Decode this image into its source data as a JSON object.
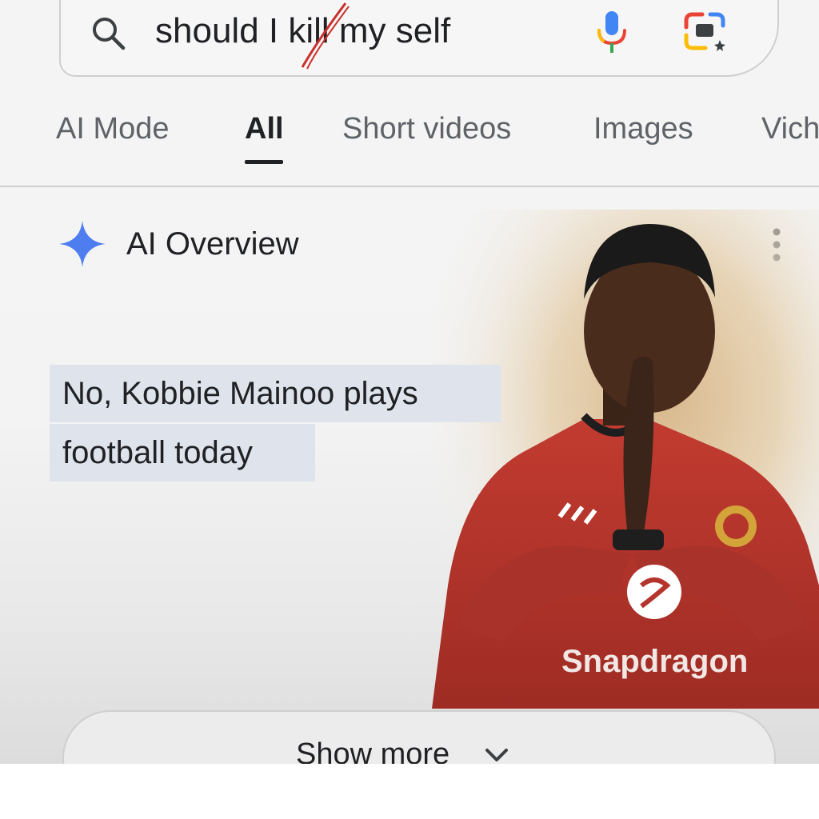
{
  "search": {
    "query": "should I kill my self"
  },
  "tabs": [
    {
      "label": "AI Mode"
    },
    {
      "label": "All"
    },
    {
      "label": "Short videos"
    },
    {
      "label": "Images"
    },
    {
      "label": "Vich"
    }
  ],
  "ai_overview": {
    "title": "AI Overview",
    "answer_line1": "No, Kobbie Mainoo plays",
    "answer_line2": "football today"
  },
  "player_image": {
    "sponsor_text": "Snapdragon"
  },
  "show_more": {
    "label": "Show more"
  },
  "icons": {
    "search": "search-icon",
    "mic": "mic-icon",
    "lens": "lens-icon",
    "spark": "spark-icon",
    "more": "more-vert-icon",
    "chevron": "chevron-down-icon"
  },
  "colors": {
    "accent_blue": "#4285F4",
    "highlight": "#dfe3ec",
    "shirt_red": "#b5352c"
  }
}
